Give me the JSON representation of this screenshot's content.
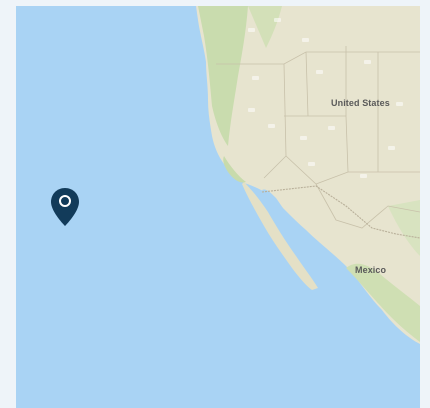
{
  "map": {
    "water_color": "#a9d3f4",
    "land_color": "#e7e4cf",
    "labels": {
      "country_1": "United States",
      "country_2": "Mexico"
    },
    "marker": {
      "icon": "map-pin-icon",
      "color": "#123b5a"
    }
  }
}
